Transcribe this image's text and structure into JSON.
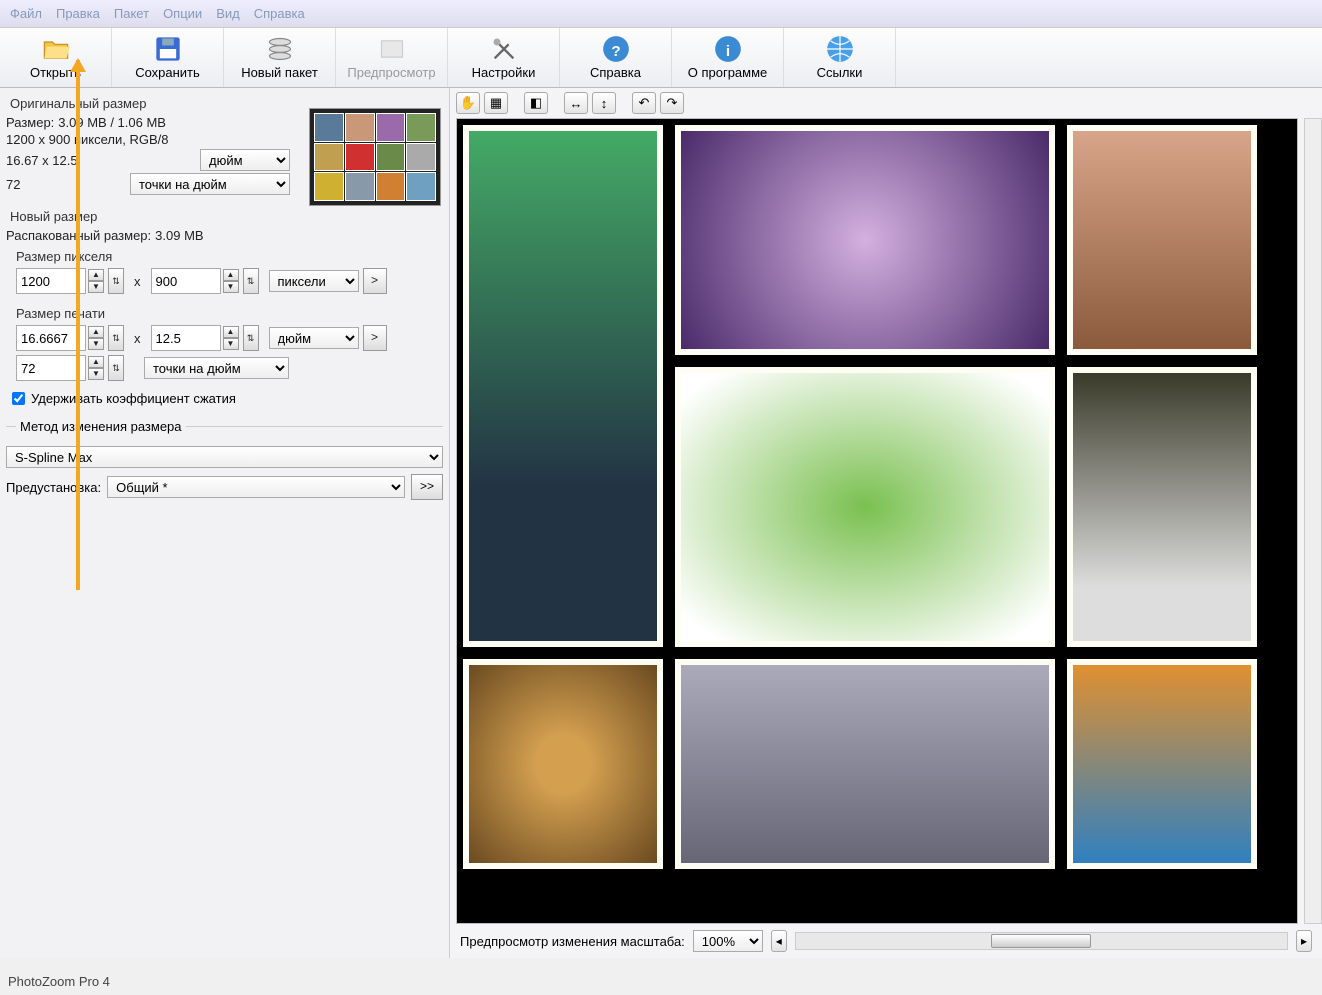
{
  "menu": {
    "file": "Файл",
    "edit": "Правка",
    "batch": "Пакет",
    "options": "Опции",
    "view": "Вид",
    "help": "Справка"
  },
  "toolbar": {
    "open": "Открыть",
    "save": "Сохранить",
    "newbatch": "Новый пакет",
    "preview": "Предпросмотр",
    "settings": "Настройки",
    "help": "Справка",
    "about": "О программе",
    "links": "Ссылки"
  },
  "original": {
    "title": "Оригинальный размер",
    "size_label": "Размер:",
    "size_value": "3.09 MB / 1.06 MB",
    "dims": "1200 x 900 пиксели, RGB/8",
    "print_dims": "16.67 x 12.5",
    "unit": "дюйм",
    "resolution": "72",
    "res_unit": "точки на дюйм"
  },
  "newsize": {
    "title": "Новый размер",
    "unpacked_label": "Распакованный размер:",
    "unpacked_value": "3.09 MB",
    "pixel_size_label": "Размер пикселя",
    "width_px": "1200",
    "height_px": "900",
    "px_unit": "пиксели",
    "print_size_label": "Размер печати",
    "width_print": "16.6667",
    "height_print": "12.5",
    "print_unit": "дюйм",
    "resolution": "72",
    "res_unit": "точки на дюйм",
    "x": "x",
    "arrow": ">",
    "keep_ratio": "Удерживать коэффициент сжатия"
  },
  "method": {
    "title": "Метод изменения размера",
    "algo": "S-Spline Max",
    "preset_label": "Предустановка:",
    "preset_value": "Общий *",
    "more": ">>"
  },
  "preview_bar": {
    "label": "Предпросмотр изменения масштаба:",
    "zoom": "100%"
  },
  "status": "PhotoZoom Pro 4"
}
